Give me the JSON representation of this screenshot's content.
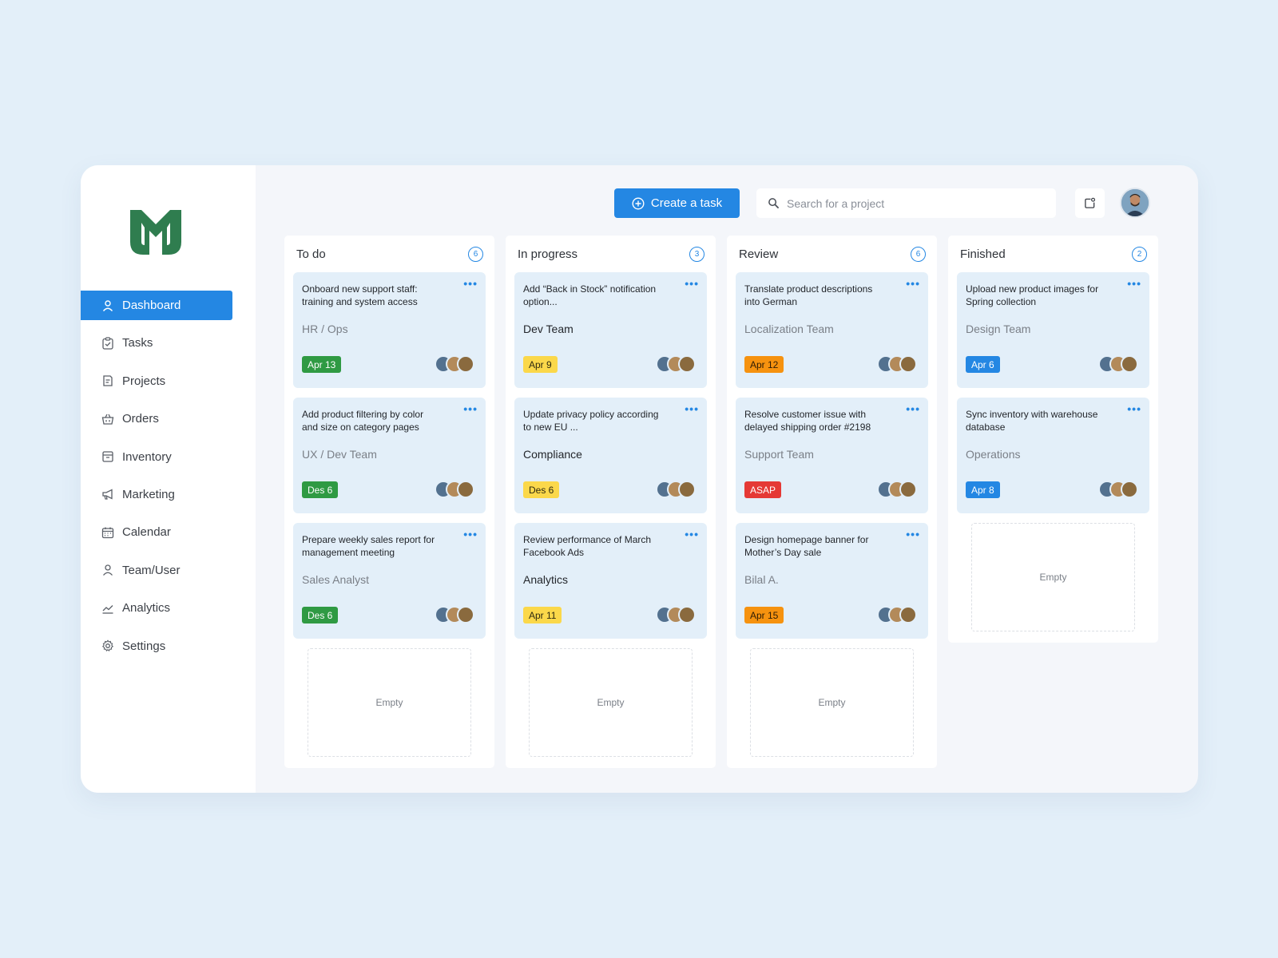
{
  "brand": {
    "logo_color": "#2f7d4f"
  },
  "sidebar": {
    "items": [
      {
        "label": "Dashboard",
        "icon": "user-icon",
        "active": true
      },
      {
        "label": "Tasks",
        "icon": "clipboard-icon"
      },
      {
        "label": "Projects",
        "icon": "document-icon"
      },
      {
        "label": "Orders",
        "icon": "basket-icon"
      },
      {
        "label": "Inventory",
        "icon": "box-icon"
      },
      {
        "label": "Marketing",
        "icon": "megaphone-icon"
      },
      {
        "label": "Calendar",
        "icon": "calendar-icon"
      },
      {
        "label": "Team/User",
        "icon": "user-icon"
      },
      {
        "label": "Analytics",
        "icon": "chart-icon"
      },
      {
        "label": "Settings",
        "icon": "gear-icon"
      }
    ]
  },
  "header": {
    "create_label": "Create a task",
    "search_placeholder": "Search for a project"
  },
  "colors": {
    "accent": "#2487e3",
    "card_bg": "#e3eff9"
  },
  "board": {
    "empty_label": "Empty",
    "columns": [
      {
        "title": "To do",
        "count": "6",
        "cards": [
          {
            "title": "Onboard new support staff: training and system access",
            "team": "HR / Ops",
            "tag": "Apr 13",
            "tag_color": "green"
          },
          {
            "title": "Add product filtering by color and size on category pages",
            "team": "UX / Dev Team",
            "tag": "Des 6",
            "tag_color": "green"
          },
          {
            "title": "Prepare weekly sales report for management meeting",
            "team": "Sales Analyst",
            "tag": "Des 6",
            "tag_color": "green"
          }
        ]
      },
      {
        "title": "In progress",
        "count": "3",
        "cards": [
          {
            "title": "Add “Back in Stock” notification option...",
            "team": "Dev Team",
            "tag": "Apr 9",
            "tag_color": "yellow"
          },
          {
            "title": "Update privacy policy according to new EU ...",
            "team": "Compliance",
            "tag": "Des 6",
            "tag_color": "yellow"
          },
          {
            "title": "Review performance of March Facebook Ads",
            "team": "Analytics",
            "tag": "Apr 11",
            "tag_color": "yellow"
          }
        ]
      },
      {
        "title": "Review",
        "count": "6",
        "cards": [
          {
            "title": "Translate product descriptions into German",
            "team": "Localization Team",
            "tag": "Apr 12",
            "tag_color": "orange"
          },
          {
            "title": "Resolve customer issue with delayed shipping order #2198",
            "team": "Support Team",
            "tag": "ASAP",
            "tag_color": "red"
          },
          {
            "title": "Design homepage banner for Mother’s Day sale",
            "team": "Bilal A.",
            "tag": "Apr 15",
            "tag_color": "orange"
          }
        ]
      },
      {
        "title": "Finished",
        "count": "2",
        "cards": [
          {
            "title": "Upload new product images for Spring collection",
            "team": "Design Team",
            "tag": "Apr 6",
            "tag_color": "blue"
          },
          {
            "title": "Sync inventory with warehouse database",
            "team": "Operations",
            "tag": "Apr 8",
            "tag_color": "blue"
          }
        ]
      }
    ]
  }
}
